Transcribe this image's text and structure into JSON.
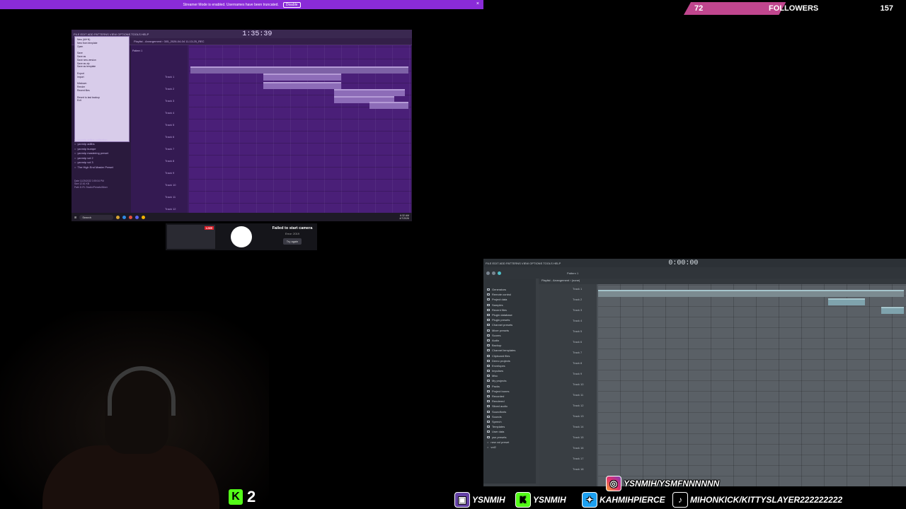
{
  "banner": {
    "text": "Streamer Mode is enabled. Usernames have been truncated.",
    "disable": "Disable",
    "close": "×"
  },
  "followers": {
    "current": "72",
    "label": "FOLLOWERS",
    "goal": "157",
    "progress_pct": 46
  },
  "fl_main": {
    "menu": "FILE EDIT ADD PATTERNS VIEW OPTIONS TOOLS HELP",
    "time": "1:35:39",
    "playlist_title": "Playlist - Arrangement › 305_2026-04-04 11-13-25_REC",
    "file_menu": [
      "New (Alt+N)",
      "New from template",
      "Open",
      "",
      "Save",
      "Save as",
      "Save new version",
      "Save as zip",
      "Save as template",
      "",
      "Export",
      "Import",
      "",
      "Mixdown",
      "Render",
      "Recent files",
      "",
      "Revert to last backup",
      "Exit"
    ],
    "sidebar_items": [
      "ysnmip adlibs collection",
      "ysnmip adlibs",
      "ysnmip bumpe",
      "ysnmip mastering preset",
      "ysnmip vol 2",
      "ysnmip vol 3",
      "The High End Master Preset"
    ],
    "date_info": [
      "Date  11/25/2022 3:59:34 PM",
      "Size  12.61 KB",
      "Path  D:\\FL Studio\\Presets\\Mixer"
    ],
    "tracks": [
      "Track 1",
      "Track 2",
      "Track 3",
      "Track 4",
      "Track 5",
      "Track 6",
      "Track 7",
      "Track 8",
      "Track 9",
      "Track 10",
      "Track 11",
      "Track 12"
    ],
    "pattern": "Pattern 1",
    "taskbar": {
      "search": "Search",
      "time": "6:32 AM",
      "date": "4/7/2026"
    }
  },
  "strip": {
    "live": "LIVE",
    "error": "Failed to start camera",
    "error_sub": "Error: 2019",
    "try": "Try again"
  },
  "kick": {
    "count": "2"
  },
  "fl_second": {
    "menu": "FILE EDIT ADD PATTERNS VIEW OPTIONS TOOLS HELP",
    "time": "0:00:00",
    "playlist_title": "Playlist - Arrangement › (none)",
    "browser": [
      "Generators",
      "Remote control",
      "Project data",
      "Samples",
      "Recent files",
      "Plugin database",
      "Plugin presets",
      "Channel presets",
      "Mixer presets",
      "Scores",
      "Audio",
      "Backup",
      "Channel templates",
      "Clipboard files",
      "Demo projects",
      "Envelopes",
      "Impulses",
      "Misc",
      "My projects",
      "Packs",
      "Project bones",
      "Recorded",
      "Rendered",
      "Sliced audio",
      "Soundfonts",
      "Sounds",
      "Speech",
      "Templates",
      "User data",
      "ysn presets",
      "new vol preset",
      "vol2"
    ],
    "tracks": [
      "Track 1",
      "Track 2",
      "Track 3",
      "Track 4",
      "Track 5",
      "Track 6",
      "Track 7",
      "Track 8",
      "Track 9",
      "Track 10",
      "Track 11",
      "Track 12",
      "Track 13",
      "Track 14",
      "Track 15",
      "Track 16",
      "Track 17",
      "Track 18"
    ],
    "pattern": "Pattern 1"
  },
  "socials": {
    "instagram": "YSNMIH/YSMFNNNNNN",
    "twitch": "YSNMIH",
    "kick": "YSNMIH",
    "twitter": "KAHMIHPIERCE",
    "tiktok": "MIHONKICK/KITTYSLAYER222222222"
  },
  "colors": {
    "banner": "#8a2bd8",
    "followers_fill": "#c0468e",
    "kick_green": "#53fc18"
  }
}
